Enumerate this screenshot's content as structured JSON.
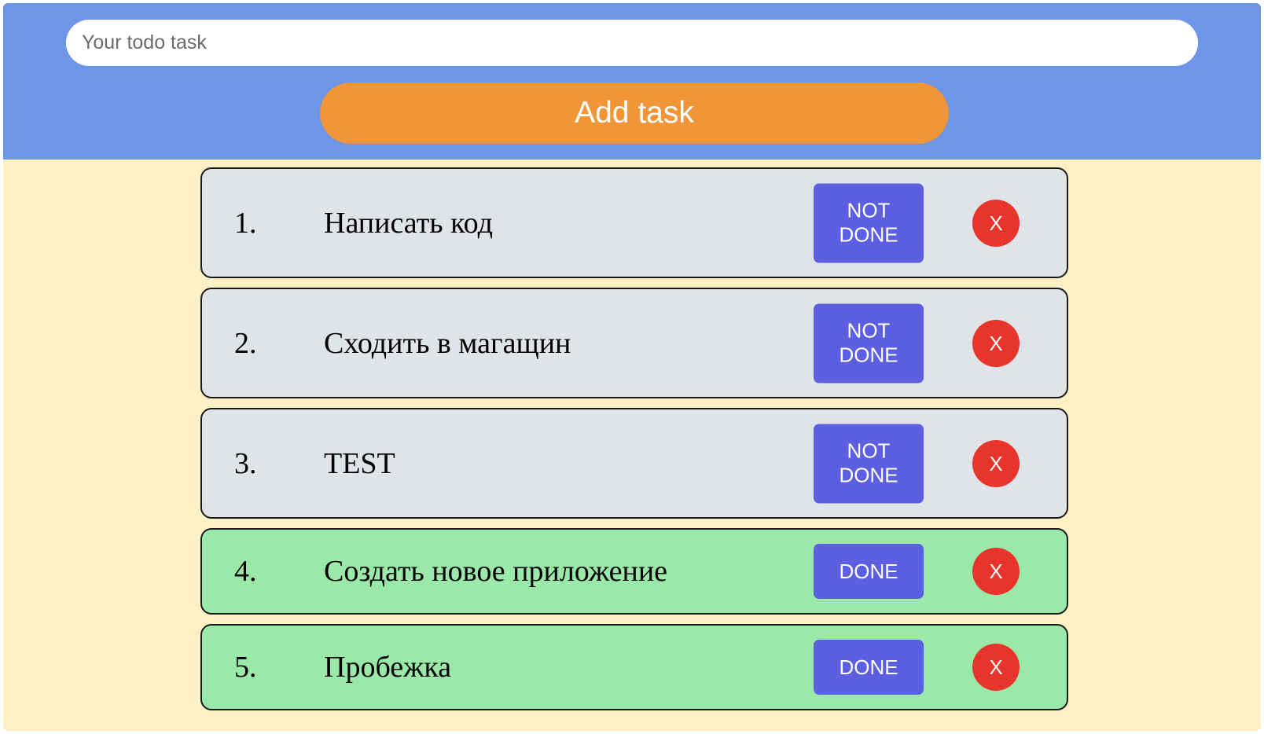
{
  "header": {
    "input_placeholder": "Your todo task",
    "input_value": "",
    "add_button_label": "Add task"
  },
  "tasks": [
    {
      "number": "1.",
      "text": "Написать код",
      "status_label": "NOT\nDONE",
      "done": false,
      "delete_label": "X"
    },
    {
      "number": "2.",
      "text": "Сходить в магащин",
      "status_label": "NOT\nDONE",
      "done": false,
      "delete_label": "X"
    },
    {
      "number": "3.",
      "text": "TEST",
      "status_label": "NOT\nDONE",
      "done": false,
      "delete_label": "X"
    },
    {
      "number": "4.",
      "text": "Создать новое приложение",
      "status_label": "DONE",
      "done": true,
      "delete_label": "X"
    },
    {
      "number": "5.",
      "text": "Пробежка",
      "status_label": "DONE",
      "done": true,
      "delete_label": "X"
    }
  ],
  "colors": {
    "header_bg": "#6f95e6",
    "page_bg": "#fdf1c5",
    "add_button": "#f09538",
    "not_done_row": "#e0e3e8",
    "done_row": "#9ae9a8",
    "status_button": "#5b5fe0",
    "delete_button": "#e8352b"
  }
}
